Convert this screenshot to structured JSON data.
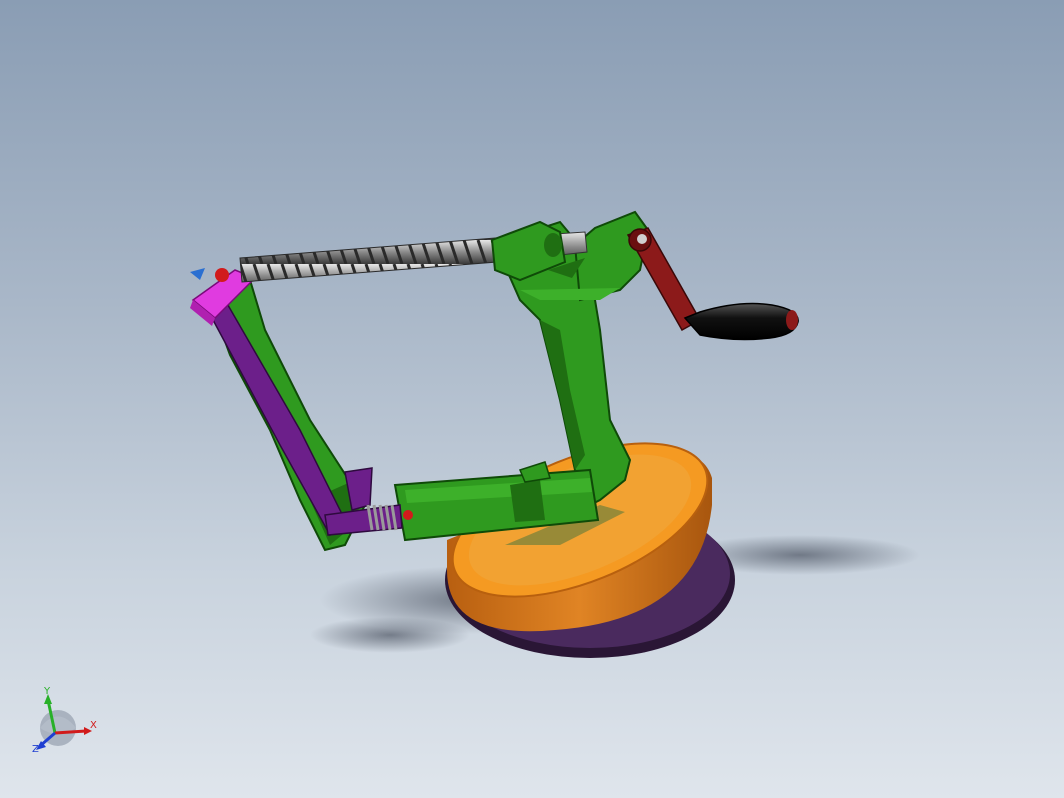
{
  "view": {
    "background_top": "#8a9db4",
    "background_bottom": "#dfe5ec"
  },
  "model": {
    "colors": {
      "frame": "#2f9a1f",
      "frame_dark": "#1f6f12",
      "arm": "#6c1f8a",
      "blade_block": "#e03be0",
      "crank": "#8c1a1a",
      "handle": "#111111",
      "base_top": "#f2961f",
      "base_side": "#c9701a",
      "suction": "#3a1f4a",
      "spring": "#d0d0d0",
      "screw": "#7a7a7a"
    },
    "icons": [
      "screw-shaft",
      "crank-handle",
      "suction-base",
      "spring"
    ]
  },
  "triad": {
    "x_label": "X",
    "y_label": "Y",
    "z_label": "Z",
    "x_color": "#d11b1b",
    "y_color": "#28b028",
    "z_color": "#1f3fd1"
  }
}
